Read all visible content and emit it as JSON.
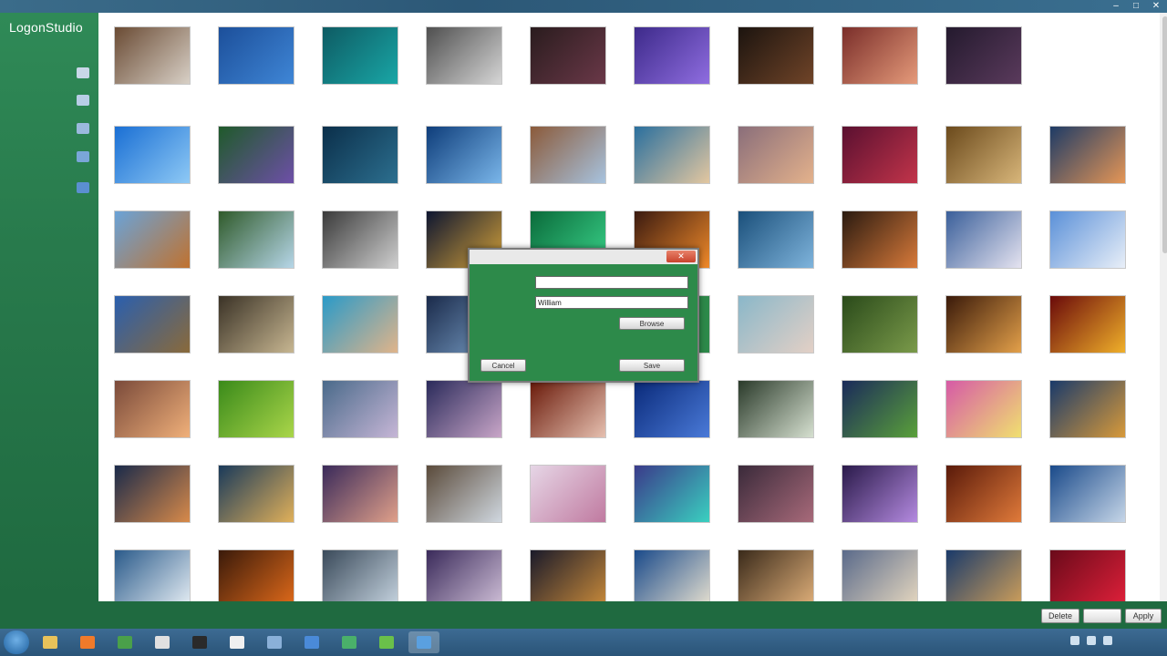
{
  "window": {
    "title": ""
  },
  "app": {
    "brand": "LogonStudio"
  },
  "sidebar": {
    "items": [
      {
        "label": "",
        "icon": "folder-icon",
        "color": "#c9d7e8"
      },
      {
        "label": "",
        "icon": "download-icon",
        "color": "#b8cde6"
      },
      {
        "label": "",
        "icon": "image-icon",
        "color": "#9bb9dd"
      },
      {
        "label": "",
        "icon": "export-icon",
        "color": "#7aa6d8"
      },
      {
        "label": "",
        "icon": "help-icon",
        "color": "#5b8fd0"
      }
    ]
  },
  "sections": [
    {
      "label": ""
    },
    {
      "label": ""
    }
  ],
  "row_top": [
    {
      "caption": "",
      "c1": "#6a4b34",
      "c2": "#d8d0c6"
    },
    {
      "caption": "",
      "c1": "#1c4f9a",
      "c2": "#3f86d6"
    },
    {
      "caption": "",
      "c1": "#0e5b63",
      "c2": "#19a6a6"
    },
    {
      "caption": "",
      "c1": "#4f4f4f",
      "c2": "#d6d6d6"
    },
    {
      "caption": "",
      "c1": "#2a1c1e",
      "c2": "#6a3848"
    },
    {
      "caption": "",
      "c1": "#3d2a8a",
      "c2": "#8f6de0"
    },
    {
      "caption": "",
      "c1": "#1c140f",
      "c2": "#704428"
    },
    {
      "caption": "",
      "c1": "#7a2e2a",
      "c2": "#e59a7a"
    },
    {
      "caption": "",
      "c1": "#241a2e",
      "c2": "#5a3a5c"
    }
  ],
  "grid": [
    [
      {
        "caption": "",
        "c1": "#1a6fd4",
        "c2": "#8ec9f5"
      },
      {
        "caption": "",
        "c1": "#1f5a2a",
        "c2": "#6e4fa8"
      },
      {
        "caption": "",
        "c1": "#0b2f4a",
        "c2": "#2c6f8f"
      },
      {
        "caption": "",
        "c1": "#0e3d7a",
        "c2": "#7ab6ea"
      },
      {
        "caption": "",
        "c1": "#8b5a3a",
        "c2": "#a7c3df"
      },
      {
        "caption": "",
        "c1": "#2a6f9e",
        "c2": "#e3c7a0"
      },
      {
        "caption": "",
        "c1": "#8a6e7a",
        "c2": "#e4b28c"
      },
      {
        "caption": "",
        "c1": "#5a1030",
        "c2": "#c2344a"
      },
      {
        "caption": "",
        "c1": "#6b4a1c",
        "c2": "#d8b67a"
      },
      {
        "caption": "",
        "c1": "#1e3b66",
        "c2": "#e59656"
      }
    ],
    [
      {
        "caption": "",
        "c1": "#6aa3d8",
        "c2": "#c0722f"
      },
      {
        "caption": "",
        "c1": "#2f5a2a",
        "c2": "#b6d6e8"
      },
      {
        "caption": "",
        "c1": "#3a3a3a",
        "c2": "#cfcfcf"
      },
      {
        "caption": "",
        "c1": "#0d1530",
        "c2": "#d4a23a"
      },
      {
        "caption": "",
        "c1": "#0a6a3a",
        "c2": "#3ad38a"
      },
      {
        "caption": "",
        "c1": "#3a1a10",
        "c2": "#f08a2a"
      },
      {
        "caption": "",
        "c1": "#1a4f7a",
        "c2": "#7fb4dc"
      },
      {
        "caption": "",
        "c1": "#2a1a10",
        "c2": "#d87a3a"
      },
      {
        "caption": "",
        "c1": "#3a5f9a",
        "c2": "#e5e3f0"
      },
      {
        "caption": "",
        "c1": "#5a90d8",
        "c2": "#e9eff8"
      }
    ],
    [
      {
        "caption": "",
        "c1": "#2a5fae",
        "c2": "#8a6a3a"
      },
      {
        "caption": "",
        "c1": "#3a3226",
        "c2": "#c7b691"
      },
      {
        "caption": "",
        "c1": "#2a9ac8",
        "c2": "#e0b48a"
      },
      {
        "caption": "",
        "c1": "#1a2a4a",
        "c2": "#7aa0c8"
      },
      {
        "caption": "",
        "c1": "#2d8a4a",
        "c2": "#2d8a4a"
      },
      {
        "caption": "",
        "c1": "#2d8a4a",
        "c2": "#2d8a4a"
      },
      {
        "caption": "",
        "c1": "#8ab7c9",
        "c2": "#e3d0c6"
      },
      {
        "caption": "",
        "c1": "#2a4a1a",
        "c2": "#7a9a4a"
      },
      {
        "caption": "",
        "c1": "#3a1a0a",
        "c2": "#e3a04a"
      },
      {
        "caption": "",
        "c1": "#6a0a0a",
        "c2": "#f0b02a"
      }
    ],
    [
      {
        "caption": "",
        "c1": "#7a4a3a",
        "c2": "#f0b07a"
      },
      {
        "caption": "",
        "c1": "#3a8a1a",
        "c2": "#aad64a"
      },
      {
        "caption": "",
        "c1": "#4a6a8a",
        "c2": "#c6b6d6"
      },
      {
        "caption": "",
        "c1": "#2a2a5a",
        "c2": "#c9a6c8"
      },
      {
        "caption": "",
        "c1": "#6a1a0a",
        "c2": "#e6c0b0"
      },
      {
        "caption": "",
        "c1": "#0a2a7a",
        "c2": "#4a7ad8"
      },
      {
        "caption": "",
        "c1": "#2a3a2a",
        "c2": "#d6e0d0"
      },
      {
        "caption": "",
        "c1": "#1a2a5a",
        "c2": "#5aa03a"
      },
      {
        "caption": "",
        "c1": "#d65aa6",
        "c2": "#f0e070"
      },
      {
        "caption": "",
        "c1": "#1a3a6a",
        "c2": "#d89a3a"
      }
    ],
    [
      {
        "caption": "",
        "c1": "#1a2a4a",
        "c2": "#d88a4a"
      },
      {
        "caption": "",
        "c1": "#1a3a5a",
        "c2": "#e0b05a"
      },
      {
        "caption": "",
        "c1": "#3a2a5a",
        "c2": "#e0a08a"
      },
      {
        "caption": "",
        "c1": "#5a4a3a",
        "c2": "#d0d8e0"
      },
      {
        "caption": "",
        "c1": "#e6d6e6",
        "c2": "#c07aa0"
      },
      {
        "caption": "",
        "c1": "#3a3a8a",
        "c2": "#3ad0c0"
      },
      {
        "caption": "",
        "c1": "#3a2a3a",
        "c2": "#a86a7a"
      },
      {
        "caption": "",
        "c1": "#2a1a4a",
        "c2": "#b48ae0"
      },
      {
        "caption": "",
        "c1": "#5a1a0a",
        "c2": "#e07a3a"
      },
      {
        "caption": "",
        "c1": "#1a4a8a",
        "c2": "#c6d6e8"
      }
    ],
    [
      {
        "caption": "",
        "c1": "#2a5a8a",
        "c2": "#e6eef4"
      },
      {
        "caption": "",
        "c1": "#3a1a0a",
        "c2": "#e06a1a"
      },
      {
        "caption": "",
        "c1": "#3a4a5a",
        "c2": "#c6d4e0"
      },
      {
        "caption": "",
        "c1": "#3a2a5a",
        "c2": "#d0c0d8"
      },
      {
        "caption": "",
        "c1": "#1a1a2a",
        "c2": "#c88a3a"
      },
      {
        "caption": "",
        "c1": "#1a4a8a",
        "c2": "#e6e0d0"
      },
      {
        "caption": "",
        "c1": "#3a2a1a",
        "c2": "#e0b07a"
      },
      {
        "caption": "",
        "c1": "#5a6a8a",
        "c2": "#e6d8c0"
      },
      {
        "caption": "",
        "c1": "#1a3a6a",
        "c2": "#d0a05a"
      },
      {
        "caption": "",
        "c1": "#6a0a1a",
        "c2": "#e0203a"
      }
    ]
  ],
  "dialog": {
    "title": "",
    "close": "✕",
    "label1": "",
    "label2": "",
    "label3": "",
    "field1_value": "",
    "field2_value": "William",
    "browse_label": "Browse",
    "cancel_label": "Cancel",
    "save_label": "Save"
  },
  "bottom": {
    "status_line1": "",
    "status_line2": "",
    "delete_label": "Delete",
    "middle_label": "",
    "apply_label": "Apply"
  },
  "taskbar": {
    "apps": [
      {
        "icon": "folder-icon",
        "color": "#e8c25a"
      },
      {
        "icon": "app-icon",
        "color": "#f07a2a"
      },
      {
        "icon": "browser-icon",
        "color": "#4aa04a"
      },
      {
        "icon": "vnc-icon",
        "color": "#e0e0e0"
      },
      {
        "icon": "terminal-icon",
        "color": "#2a2a2a"
      },
      {
        "icon": "notepad-icon",
        "color": "#f0f0f0"
      },
      {
        "icon": "window-icon",
        "color": "#8ab0d8"
      },
      {
        "icon": "network-icon",
        "color": "#4a8ad8"
      },
      {
        "icon": "app-icon",
        "color": "#4ab06a"
      },
      {
        "icon": "app-icon",
        "color": "#6ac04a"
      },
      {
        "icon": "logonstudio-icon",
        "color": "#5aa0e0"
      }
    ],
    "clock_time": "",
    "clock_date": ""
  }
}
